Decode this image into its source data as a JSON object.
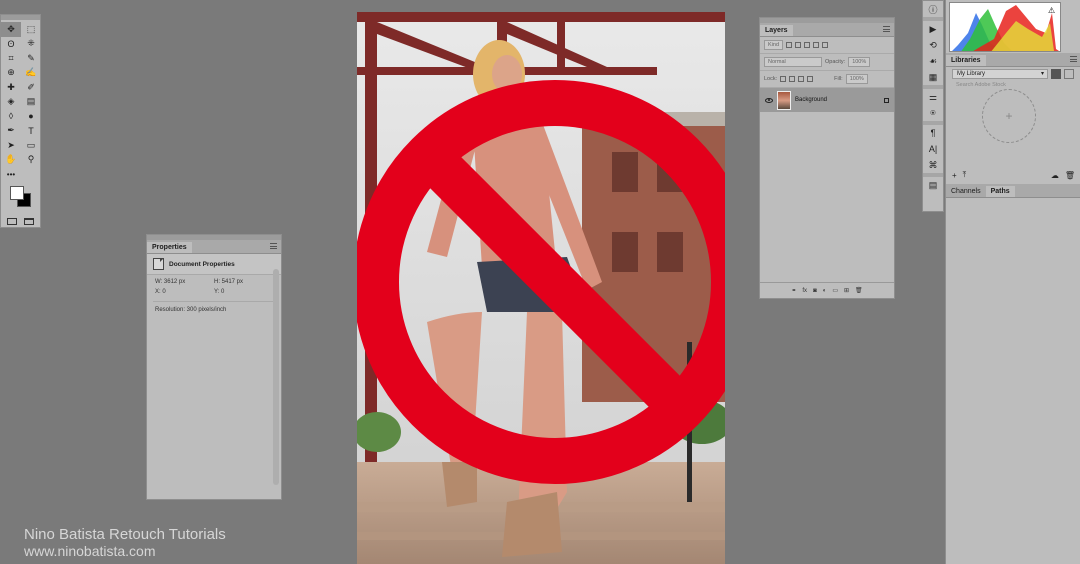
{
  "tools": {
    "items": [
      "✥",
      "⬚",
      "ʘ",
      "⁜",
      "⌗",
      "✎",
      "⊕",
      "✍",
      "✚",
      "✐",
      "◈",
      "▤",
      "◊",
      "●",
      "✒",
      "T",
      "➤",
      "▭",
      "✋",
      "⚲"
    ]
  },
  "properties": {
    "tab": "Properties",
    "title": "Document Properties",
    "w": "W: 3612 px",
    "h": "H: 5417 px",
    "x": "X: 0",
    "y": "Y: 0",
    "resolution": "Resolution: 300 pixels/inch"
  },
  "layers": {
    "tab": "Layers",
    "kind": "Kind",
    "blend": "Normal",
    "opacity": "Opacity:",
    "opacity_val": "100%",
    "lock": "Lock:",
    "fill": "Fill:",
    "fill_val": "100%",
    "layer_name": "Background"
  },
  "libraries": {
    "tab": "Libraries",
    "library": "My Library",
    "search": "Search Adobe Stock",
    "add": "+"
  },
  "paths_panel": {
    "tab1": "Channels",
    "tab2": "Paths"
  },
  "watermark": {
    "line1": "Nino Batista Retouch Tutorials",
    "line2": "www.ninobatista.com"
  },
  "colors": {
    "prohibition_red": "#e3001b",
    "panel": "#bdbdbd",
    "workspace": "#7a7a7a"
  }
}
